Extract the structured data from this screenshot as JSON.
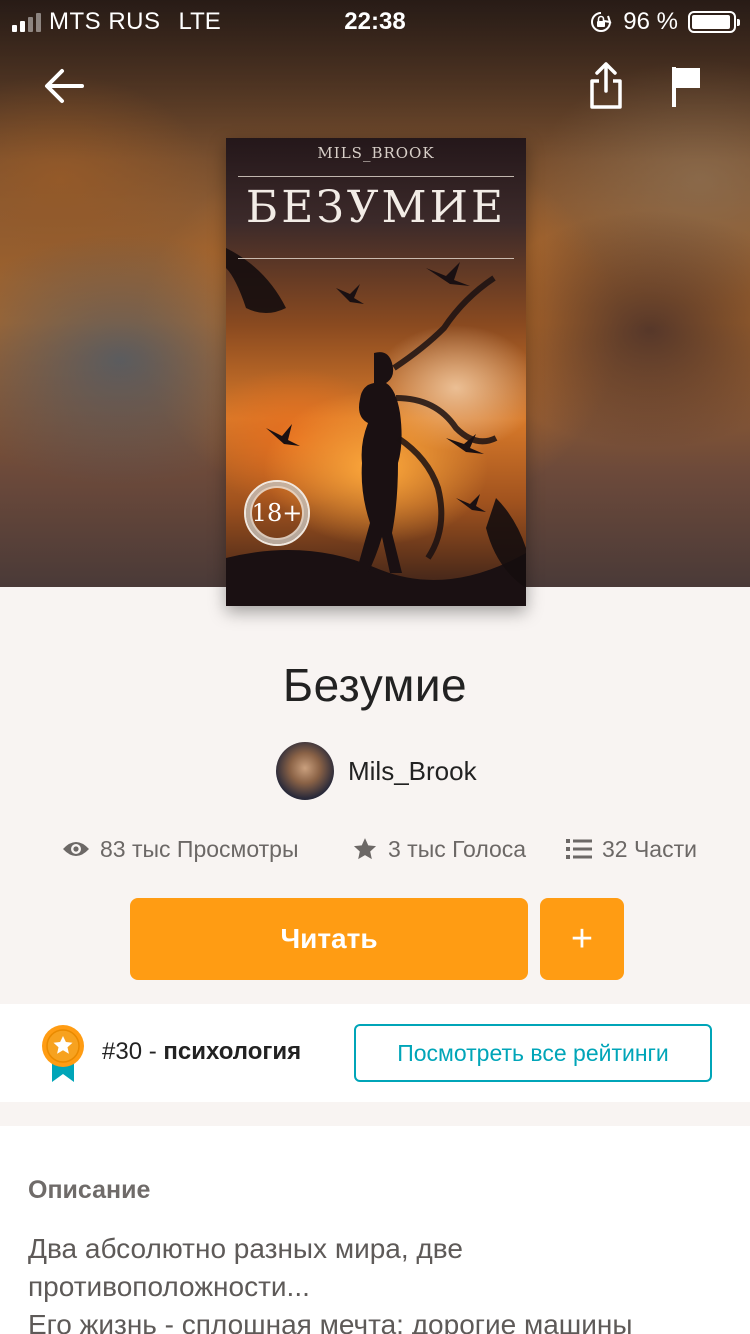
{
  "status_bar": {
    "carrier": "MTS RUS",
    "network": "LTE",
    "time": "22:38",
    "battery": "96 %",
    "battery_level": 0.96
  },
  "nav": {
    "back_icon": "arrow-left-icon",
    "share_icon": "share-icon",
    "report_icon": "flag-icon"
  },
  "cover": {
    "author": "MILS_BROOK",
    "title": "БЕЗУМИЕ",
    "age_rating": "18+"
  },
  "book": {
    "title": "Безумие",
    "author": "Mils_Brook"
  },
  "stats": {
    "views": "83 тыс Просмотры",
    "votes": "3 тыс Голоса",
    "parts": "32 Части"
  },
  "actions": {
    "read_label": "Читать",
    "add_label": "+"
  },
  "ranking": {
    "rank": "#30",
    "separator": " - ",
    "category": "психология",
    "view_all_label": "Посмотреть все рейтинги"
  },
  "description": {
    "heading": "Описание",
    "lines": [
      "Два абсолютно разных мира, две",
      "противоположности...",
      "Его жизнь - сплошная мечта: дорогие машины"
    ]
  },
  "colors": {
    "accent": "#ff9c13",
    "link": "#00a5b8",
    "background": "#f8f4f2"
  }
}
